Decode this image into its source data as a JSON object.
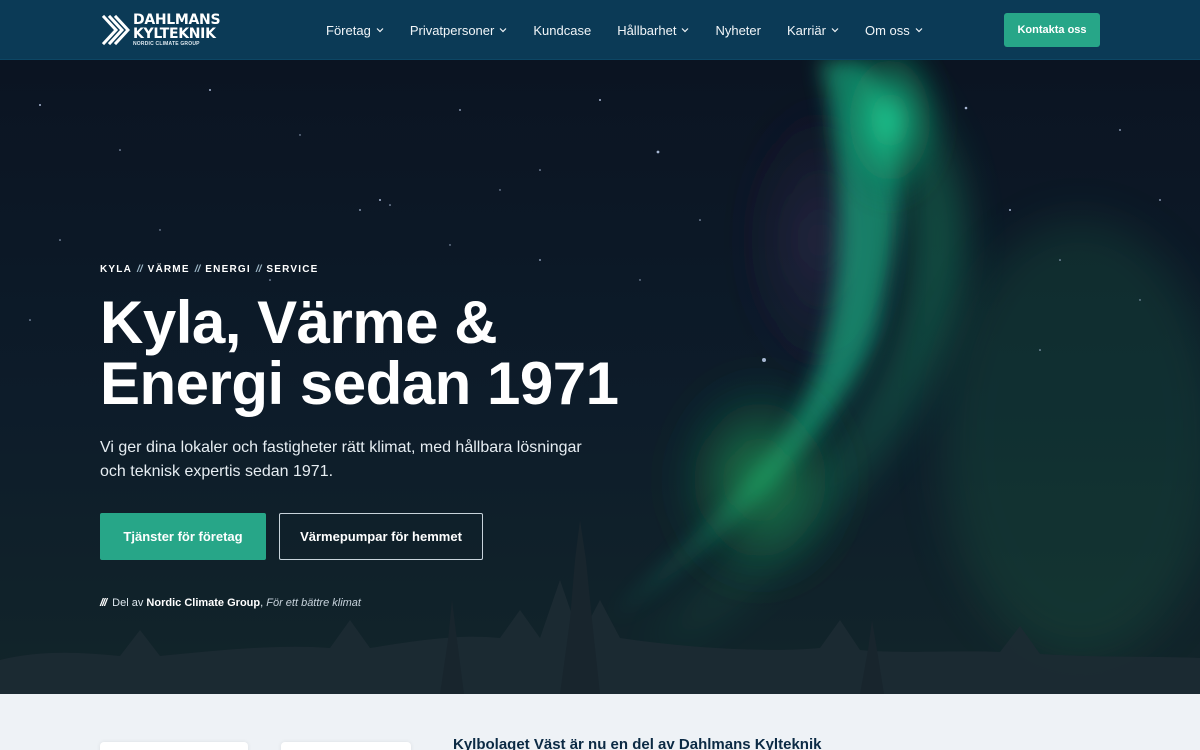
{
  "header": {
    "logo": {
      "line1": "DAHLMANS",
      "line2": "KYLTEKNIK",
      "line3": "NORDIC CLIMATE GROUP"
    },
    "nav": [
      {
        "label": "Företag",
        "dropdown": true
      },
      {
        "label": "Privatpersoner",
        "dropdown": true
      },
      {
        "label": "Kundcase",
        "dropdown": false
      },
      {
        "label": "Hållbarhet",
        "dropdown": true
      },
      {
        "label": "Nyheter",
        "dropdown": false
      },
      {
        "label": "Karriär",
        "dropdown": true
      },
      {
        "label": "Om oss",
        "dropdown": true
      }
    ],
    "cta_label": "Kontakta oss"
  },
  "hero": {
    "eyebrow": [
      "KYLA",
      "VÄRME",
      "ENERGI",
      "SERVICE"
    ],
    "eyebrow_separator": "//",
    "headline_line1": "Kyla, Värme &",
    "headline_line2": "Energi sedan 1971",
    "subtext": "Vi ger dina lokaler och fastigheter rätt klimat, med hållbara lösningar och teknisk expertis sedan 1971.",
    "primary_button": "Tjänster för företag",
    "secondary_button": "Värmepumpar för hemmet",
    "group_mark": "///",
    "group_prefix": "Del av ",
    "group_name": "Nordic Climate Group",
    "group_comma": ", ",
    "group_slogan": "För ett bättre klimat"
  },
  "below": {
    "title": "Kylbolaget Väst är nu en del av Dahlmans Kylteknik"
  },
  "colors": {
    "header_bg": "#0b3a56",
    "accent": "#27a688",
    "hero_bg": "#0a1522",
    "aurora": "#1fd38e",
    "below_bg": "#eef2f6"
  }
}
